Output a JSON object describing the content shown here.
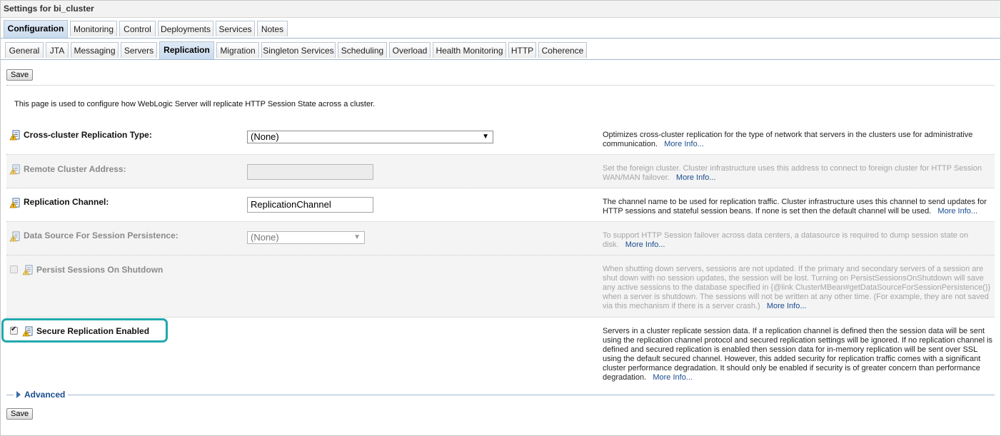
{
  "page_title": "Settings for bi_cluster",
  "main_tabs": [
    "Configuration",
    "Monitoring",
    "Control",
    "Deployments",
    "Services",
    "Notes"
  ],
  "sub_tabs": [
    "General",
    "JTA",
    "Messaging",
    "Servers",
    "Replication",
    "Migration",
    "Singleton Services",
    "Scheduling",
    "Overload",
    "Health Monitoring",
    "HTTP",
    "Coherence"
  ],
  "save_label": "Save",
  "intro": "This page is used to configure how WebLogic Server will replicate HTTP Session State across a cluster.",
  "more_info": "More Info...",
  "fields": {
    "cross_cluster": {
      "label": "Cross-cluster Replication Type:",
      "value": "(None)",
      "desc": "Optimizes cross-cluster replication for the type of network that servers in the clusters use for administrative communication."
    },
    "remote_address": {
      "label": "Remote Cluster Address:",
      "value": "",
      "desc": "Set the foreign cluster. Cluster infrastructure uses this address to connect to foreign cluster for HTTP Session WAN/MAN failover."
    },
    "replication_channel": {
      "label": "Replication Channel:",
      "value": "ReplicationChannel",
      "desc": "The channel name to be used for replication traffic. Cluster infrastructure uses this channel to send updates for HTTP sessions and stateful session beans. If none is set then the default channel will be used."
    },
    "data_source": {
      "label": "Data Source For Session Persistence:",
      "value": "(None)",
      "desc": "To support HTTP Session failover across data centers, a datasource is required to dump session state on disk."
    },
    "persist_sessions": {
      "label": "Persist Sessions On Shutdown",
      "checked": false,
      "desc": "When shutting down servers, sessions are not updated. If the primary and secondary servers of a session are shut down with no session updates, the session will be lost. Turning on PersistSessionsOnShutdown will save any active sessions to the database specified in {@link ClusterMBean#getDataSourceForSessionPersistence()} when a server is shutdown. The sessions will not be written at any other time. (For example, they are not saved via this mechanism if there is a server crash.)"
    },
    "secure_replication": {
      "label": "Secure Replication Enabled",
      "checked": true,
      "desc": "Servers in a cluster replicate session data. If a replication channel is defined then the session data will be sent using the replication channel protocol and secured replication settings will be ignored. If no replication channel is defined and secured replication is enabled then session data for in-memory replication will be sent over SSL using the default secured channel. However, this added security for replication traffic comes with a significant cluster performance degradation. It should only be enabled if security is of greater concern than performance degradation."
    }
  },
  "advanced_label": "Advanced",
  "colors": {
    "highlight": "#21a9ae",
    "link": "#1a4c8f",
    "tab_active": "#c9dbee"
  }
}
